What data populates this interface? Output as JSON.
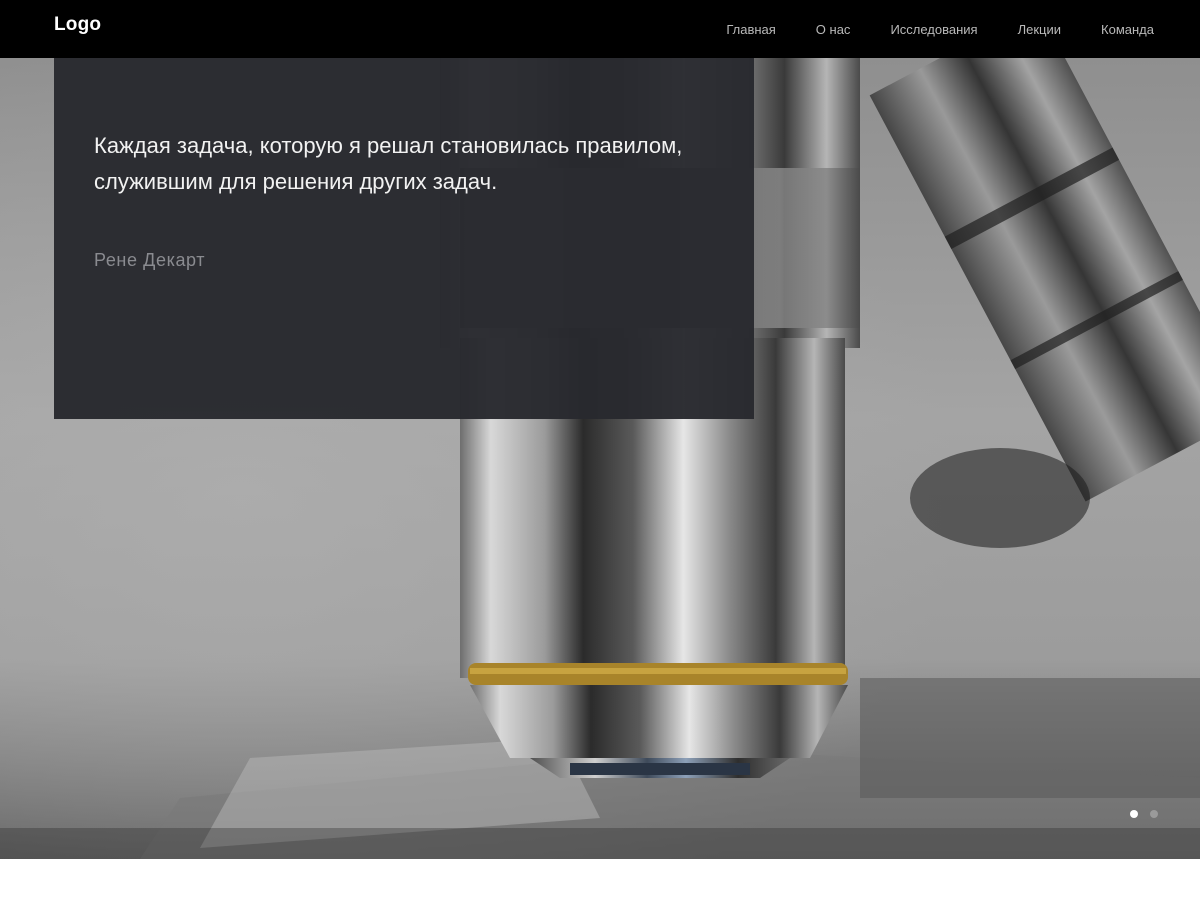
{
  "header": {
    "logo": "Logo",
    "nav": [
      {
        "label": "Главная"
      },
      {
        "label": "О нас"
      },
      {
        "label": "Исследования"
      },
      {
        "label": "Лекции"
      },
      {
        "label": "Команда"
      }
    ]
  },
  "hero": {
    "quote": "Каждая задача, которую я решал становилась правилом, служившим для решения других задач.",
    "author": "Рене Декарт",
    "background_image": "microscope-objective-photo",
    "slides_count": 2,
    "active_slide": 1
  },
  "colors": {
    "navbar": "#000000",
    "nav_text": "#b9b9b9",
    "logo_text": "#ffffff",
    "quote_box": "#28292e",
    "quote_text": "#f2f2f2",
    "author_text": "#8a8b90",
    "dot_active": "#ffffff",
    "dot_inactive": "#9a9a9a"
  }
}
